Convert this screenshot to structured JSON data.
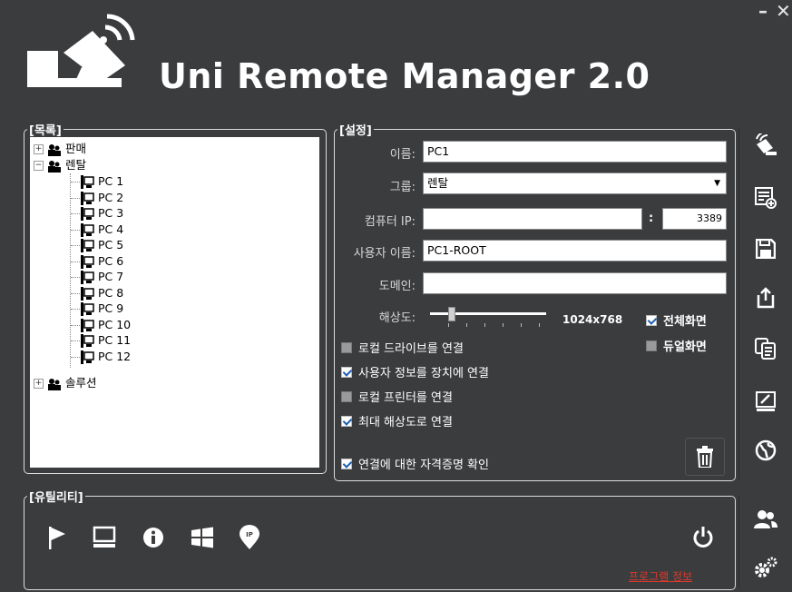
{
  "window": {
    "title": "Uni Remote Manager 2.0",
    "minimize_label": "–",
    "close_label": "✕"
  },
  "list_section": {
    "label": "[목록]",
    "tree": [
      {
        "type": "group",
        "label": "판매",
        "expanded": false
      },
      {
        "type": "group",
        "label": "렌탈",
        "expanded": true,
        "children": [
          "PC 1",
          "PC 2",
          "PC 3",
          "PC 4",
          "PC 5",
          "PC 6",
          "PC 7",
          "PC 8",
          "PC 9",
          "PC 10",
          "PC 11",
          "PC 12"
        ]
      },
      {
        "type": "group",
        "label": "솔루션",
        "expanded": false
      }
    ]
  },
  "settings": {
    "label": "[설정]",
    "name_label": "이름:",
    "name_value": "PC1",
    "group_label": "그룹:",
    "group_value": "렌탈",
    "ip_label": "컴퓨터 IP:",
    "ip_value": "",
    "port_sep": ":",
    "port_value": "3389",
    "user_label": "사용자 이름:",
    "user_value": "PC1-ROOT",
    "domain_label": "도메인:",
    "domain_value": "",
    "resolution_label": "해상도:",
    "resolution_value": "1024x768",
    "fullscreen_label": "전체화면",
    "fullscreen_checked": true,
    "dual_label": "듀얼화면",
    "dual_checked": false,
    "local_drive_label": "로컬 드라이브를 연결",
    "local_drive_checked": false,
    "user_info_label": "사용자 정보를 장치에 연결",
    "user_info_checked": true,
    "local_printer_label": "로컬 프린터를 연결",
    "local_printer_checked": false,
    "max_res_label": "최대 해상도로 연결",
    "max_res_checked": true,
    "cred_label": "연결에 대한 자격증명 확인",
    "cred_checked": true
  },
  "utility": {
    "label": "[유틸리티]",
    "program_info_link": "프로그램 정보"
  },
  "icons": {
    "side": [
      "satellite-icon",
      "add-list-icon",
      "save-icon",
      "export-icon",
      "copy-icon",
      "edit-icon",
      "globe-icon"
    ],
    "side_bottom": [
      "users-icon",
      "settings-gear-icon"
    ],
    "utility": [
      "flag-icon",
      "monitor-icon",
      "info-icon",
      "windows-icon",
      "ip-pin-icon"
    ],
    "power": "power-icon",
    "delete": "trash-icon"
  },
  "colors": {
    "background": "#3b3c3e",
    "link": "#e0392b",
    "check": "#1c5fb0"
  }
}
